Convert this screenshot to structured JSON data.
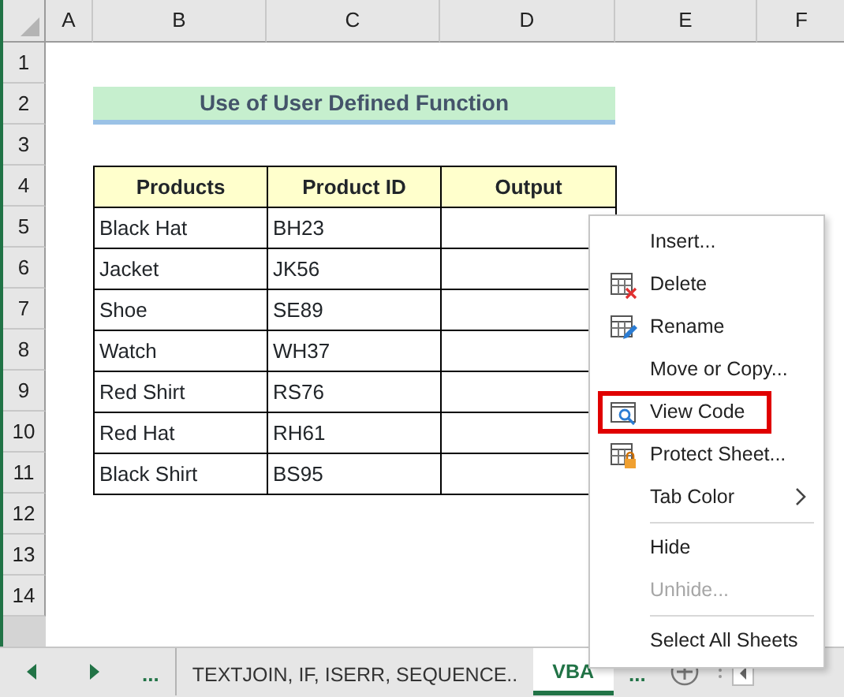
{
  "sheet": {
    "columns": [
      "A",
      "B",
      "C",
      "D",
      "E",
      "F"
    ],
    "rows": [
      "1",
      "2",
      "3",
      "4",
      "5",
      "6",
      "7",
      "8",
      "9",
      "10",
      "11",
      "12",
      "13",
      "14"
    ],
    "title": "Use of User Defined Function",
    "table": {
      "columns": [
        "Products",
        "Product ID",
        "Output"
      ],
      "rows": [
        [
          "Black Hat",
          "BH23",
          ""
        ],
        [
          "Jacket",
          "JK56",
          ""
        ],
        [
          "Shoe",
          "SE89",
          ""
        ],
        [
          "Watch",
          "WH37",
          ""
        ],
        [
          "Red Shirt",
          "RS76",
          ""
        ],
        [
          "Red Hat",
          "RH61",
          ""
        ],
        [
          "Black Shirt",
          "BS95",
          ""
        ]
      ]
    }
  },
  "context_menu": [
    {
      "kind": "item",
      "label": "Insert...",
      "disabled": false,
      "highlighted": false
    },
    {
      "kind": "item",
      "label": "Delete",
      "disabled": false,
      "highlighted": false
    },
    {
      "kind": "item",
      "label": "Rename",
      "disabled": false,
      "highlighted": false
    },
    {
      "kind": "item",
      "label": "Move or Copy...",
      "disabled": false,
      "highlighted": false
    },
    {
      "kind": "item",
      "label": "View Code",
      "disabled": false,
      "highlighted": true
    },
    {
      "kind": "item",
      "label": "Protect Sheet...",
      "disabled": false,
      "highlighted": false
    },
    {
      "kind": "submenu",
      "label": "Tab Color",
      "disabled": false,
      "highlighted": false
    },
    {
      "kind": "separator"
    },
    {
      "kind": "item",
      "label": "Hide",
      "disabled": false,
      "highlighted": false
    },
    {
      "kind": "item",
      "label": "Unhide...",
      "disabled": true,
      "highlighted": false
    },
    {
      "kind": "separator"
    },
    {
      "kind": "item",
      "label": "Select All Sheets",
      "disabled": false,
      "highlighted": false
    }
  ],
  "sheet_tabs": {
    "more_left": "...",
    "tabs": [
      {
        "label": "TEXTJOIN, IF, ISERR, SEQUENCE..",
        "selected": false
      },
      {
        "label": "VBA",
        "selected": true
      }
    ],
    "more_right": "..."
  }
}
